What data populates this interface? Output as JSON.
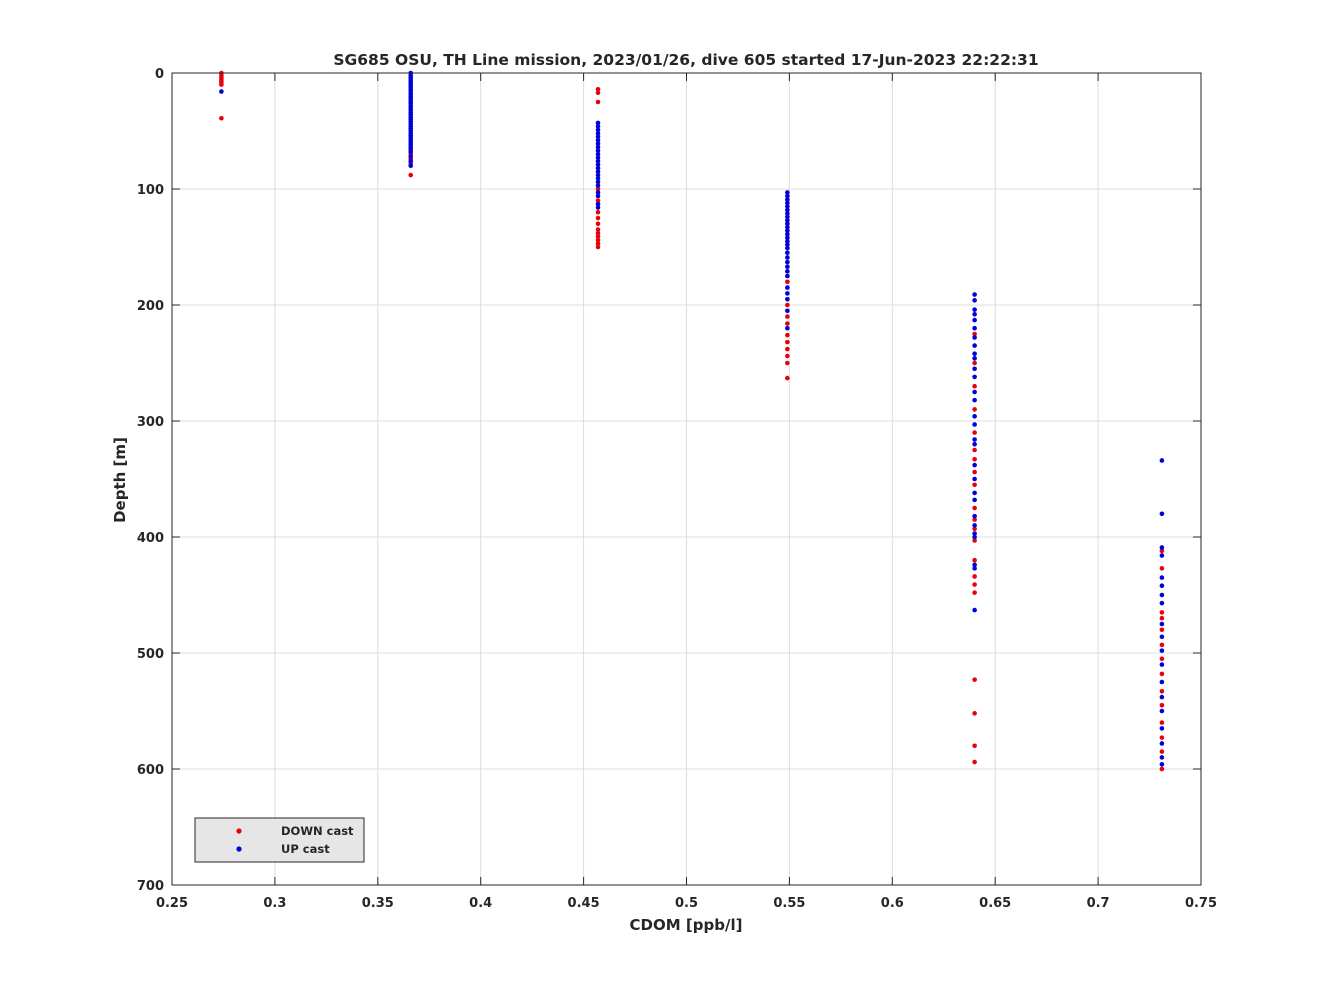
{
  "chart_data": {
    "type": "scatter",
    "title": "SG685 OSU, TH Line mission, 2023/01/26, dive 605 started 17-Jun-2023 22:22:31",
    "xlabel": "CDOM [ppb/l]",
    "ylabel": "Depth [m]",
    "xlim": [
      0.25,
      0.75
    ],
    "ylim": [
      0,
      700
    ],
    "y_reversed": true,
    "x_ticks": [
      "0.25",
      "0.3",
      "0.35",
      "0.4",
      "0.45",
      "0.5",
      "0.55",
      "0.6",
      "0.65",
      "0.7",
      "0.75"
    ],
    "y_ticks": [
      "0",
      "100",
      "200",
      "300",
      "400",
      "500",
      "600",
      "700"
    ],
    "grid": true,
    "legend_placement": "bottom-left",
    "series": [
      {
        "name": "DOWN cast",
        "color": "#e8000b",
        "points": [
          [
            0.274,
            0
          ],
          [
            0.274,
            2
          ],
          [
            0.274,
            4
          ],
          [
            0.274,
            6
          ],
          [
            0.274,
            8
          ],
          [
            0.274,
            10
          ],
          [
            0.274,
            39
          ],
          [
            0.366,
            88
          ],
          [
            0.366,
            70
          ],
          [
            0.366,
            74
          ],
          [
            0.366,
            78
          ],
          [
            0.457,
            14
          ],
          [
            0.457,
            17
          ],
          [
            0.457,
            25
          ],
          [
            0.457,
            100
          ],
          [
            0.457,
            110
          ],
          [
            0.457,
            120
          ],
          [
            0.457,
            125
          ],
          [
            0.457,
            130
          ],
          [
            0.457,
            135
          ],
          [
            0.457,
            138
          ],
          [
            0.457,
            141
          ],
          [
            0.457,
            144
          ],
          [
            0.457,
            147
          ],
          [
            0.457,
            150
          ],
          [
            0.549,
            180
          ],
          [
            0.549,
            200
          ],
          [
            0.549,
            210
          ],
          [
            0.549,
            216
          ],
          [
            0.549,
            226
          ],
          [
            0.549,
            232
          ],
          [
            0.549,
            238
          ],
          [
            0.549,
            244
          ],
          [
            0.549,
            250
          ],
          [
            0.549,
            263
          ],
          [
            0.64,
            225
          ],
          [
            0.64,
            250
          ],
          [
            0.64,
            270
          ],
          [
            0.64,
            290
          ],
          [
            0.64,
            310
          ],
          [
            0.64,
            325
          ],
          [
            0.64,
            333
          ],
          [
            0.64,
            344
          ],
          [
            0.64,
            355
          ],
          [
            0.64,
            375
          ],
          [
            0.64,
            385
          ],
          [
            0.64,
            393
          ],
          [
            0.64,
            403
          ],
          [
            0.64,
            420
          ],
          [
            0.64,
            434
          ],
          [
            0.64,
            441
          ],
          [
            0.64,
            448
          ],
          [
            0.64,
            523
          ],
          [
            0.64,
            552
          ],
          [
            0.64,
            580
          ],
          [
            0.64,
            594
          ],
          [
            0.731,
            412
          ],
          [
            0.731,
            427
          ],
          [
            0.731,
            465
          ],
          [
            0.731,
            470
          ],
          [
            0.731,
            480
          ],
          [
            0.731,
            493
          ],
          [
            0.731,
            505
          ],
          [
            0.731,
            518
          ],
          [
            0.731,
            533
          ],
          [
            0.731,
            545
          ],
          [
            0.731,
            560
          ],
          [
            0.731,
            573
          ],
          [
            0.731,
            585
          ],
          [
            0.731,
            600
          ]
        ]
      },
      {
        "name": "UP cast",
        "color": "#0000d9",
        "points": [
          [
            0.274,
            16
          ],
          [
            0.366,
            0
          ],
          [
            0.366,
            2
          ],
          [
            0.366,
            4
          ],
          [
            0.366,
            6
          ],
          [
            0.366,
            8
          ],
          [
            0.366,
            10
          ],
          [
            0.366,
            12
          ],
          [
            0.366,
            14
          ],
          [
            0.366,
            16
          ],
          [
            0.366,
            18
          ],
          [
            0.366,
            20
          ],
          [
            0.366,
            22
          ],
          [
            0.366,
            24
          ],
          [
            0.366,
            26
          ],
          [
            0.366,
            28
          ],
          [
            0.366,
            30
          ],
          [
            0.366,
            32
          ],
          [
            0.366,
            34
          ],
          [
            0.366,
            36
          ],
          [
            0.366,
            38
          ],
          [
            0.366,
            40
          ],
          [
            0.366,
            42
          ],
          [
            0.366,
            44
          ],
          [
            0.366,
            46
          ],
          [
            0.366,
            48
          ],
          [
            0.366,
            50
          ],
          [
            0.366,
            52
          ],
          [
            0.366,
            54
          ],
          [
            0.366,
            56
          ],
          [
            0.366,
            58
          ],
          [
            0.366,
            60
          ],
          [
            0.366,
            62
          ],
          [
            0.366,
            64
          ],
          [
            0.366,
            66
          ],
          [
            0.366,
            68
          ],
          [
            0.366,
            72
          ],
          [
            0.366,
            76
          ],
          [
            0.366,
            80
          ],
          [
            0.457,
            43
          ],
          [
            0.457,
            46
          ],
          [
            0.457,
            49
          ],
          [
            0.457,
            52
          ],
          [
            0.457,
            55
          ],
          [
            0.457,
            58
          ],
          [
            0.457,
            61
          ],
          [
            0.457,
            64
          ],
          [
            0.457,
            67
          ],
          [
            0.457,
            70
          ],
          [
            0.457,
            73
          ],
          [
            0.457,
            76
          ],
          [
            0.457,
            79
          ],
          [
            0.457,
            82
          ],
          [
            0.457,
            85
          ],
          [
            0.457,
            88
          ],
          [
            0.457,
            91
          ],
          [
            0.457,
            94
          ],
          [
            0.457,
            97
          ],
          [
            0.457,
            103
          ],
          [
            0.457,
            106
          ],
          [
            0.457,
            113
          ],
          [
            0.457,
            116
          ],
          [
            0.549,
            103
          ],
          [
            0.549,
            106
          ],
          [
            0.549,
            109
          ],
          [
            0.549,
            112
          ],
          [
            0.549,
            115
          ],
          [
            0.549,
            118
          ],
          [
            0.549,
            121
          ],
          [
            0.549,
            124
          ],
          [
            0.549,
            127
          ],
          [
            0.549,
            130
          ],
          [
            0.549,
            133
          ],
          [
            0.549,
            136
          ],
          [
            0.549,
            139
          ],
          [
            0.549,
            142
          ],
          [
            0.549,
            145
          ],
          [
            0.549,
            148
          ],
          [
            0.549,
            151
          ],
          [
            0.549,
            155
          ],
          [
            0.549,
            159
          ],
          [
            0.549,
            163
          ],
          [
            0.549,
            167
          ],
          [
            0.549,
            171
          ],
          [
            0.549,
            175
          ],
          [
            0.549,
            185
          ],
          [
            0.549,
            190
          ],
          [
            0.549,
            195
          ],
          [
            0.549,
            205
          ],
          [
            0.549,
            220
          ],
          [
            0.64,
            191
          ],
          [
            0.64,
            196
          ],
          [
            0.64,
            204
          ],
          [
            0.64,
            208
          ],
          [
            0.64,
            213
          ],
          [
            0.64,
            220
          ],
          [
            0.64,
            228
          ],
          [
            0.64,
            235
          ],
          [
            0.64,
            242
          ],
          [
            0.64,
            246
          ],
          [
            0.64,
            255
          ],
          [
            0.64,
            262
          ],
          [
            0.64,
            275
          ],
          [
            0.64,
            282
          ],
          [
            0.64,
            296
          ],
          [
            0.64,
            303
          ],
          [
            0.64,
            316
          ],
          [
            0.64,
            320
          ],
          [
            0.64,
            338
          ],
          [
            0.64,
            350
          ],
          [
            0.64,
            362
          ],
          [
            0.64,
            368
          ],
          [
            0.64,
            382
          ],
          [
            0.64,
            390
          ],
          [
            0.64,
            397
          ],
          [
            0.64,
            400
          ],
          [
            0.64,
            424
          ],
          [
            0.64,
            427
          ],
          [
            0.64,
            463
          ],
          [
            0.731,
            334
          ],
          [
            0.731,
            380
          ],
          [
            0.731,
            409
          ],
          [
            0.731,
            416
          ],
          [
            0.731,
            435
          ],
          [
            0.731,
            442
          ],
          [
            0.731,
            450
          ],
          [
            0.731,
            457
          ],
          [
            0.731,
            475
          ],
          [
            0.731,
            486
          ],
          [
            0.731,
            498
          ],
          [
            0.731,
            510
          ],
          [
            0.731,
            525
          ],
          [
            0.731,
            538
          ],
          [
            0.731,
            550
          ],
          [
            0.731,
            565
          ],
          [
            0.731,
            578
          ],
          [
            0.731,
            590
          ],
          [
            0.731,
            596
          ]
        ]
      }
    ]
  }
}
